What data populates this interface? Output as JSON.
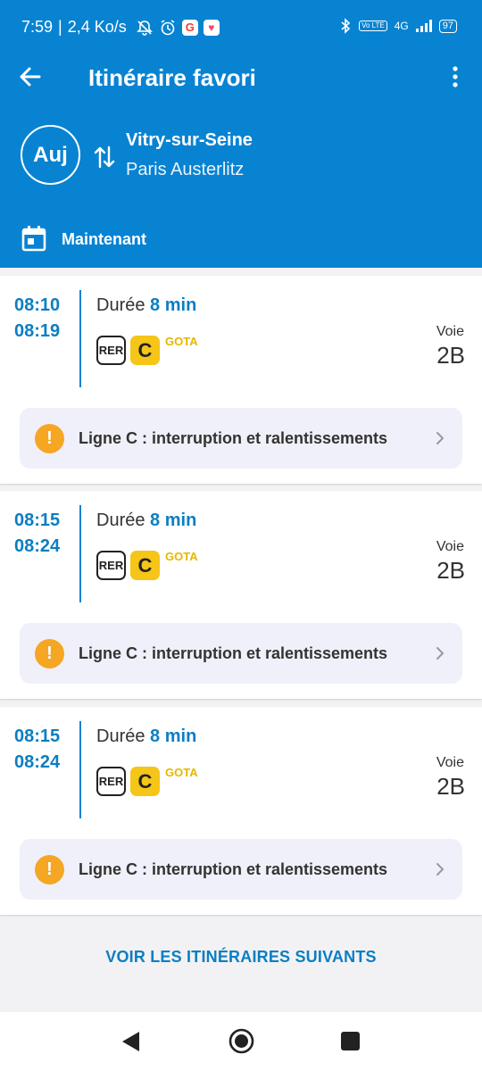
{
  "status_bar": {
    "time": "7:59",
    "separator": "|",
    "speed": "2,4 Ko/s",
    "g_icon": "G",
    "net_volte": "Vo LTE",
    "net_4g": "4G",
    "battery": "97"
  },
  "header": {
    "title": "Itinéraire favori",
    "day_badge": "Auj",
    "from": "Vitry-sur-Seine",
    "to": "Paris Austerlitz",
    "departure_when": "Maintenant"
  },
  "trips": [
    {
      "depart": "08:10",
      "arrive": "08:19",
      "duration_label": "Durée",
      "duration_value": "8 min",
      "mode": "RER",
      "line": "C",
      "mission": "GOTA",
      "platform_label": "Voie",
      "platform": "2B",
      "alert": "Ligne C : interruption et ralentissements"
    },
    {
      "depart": "08:15",
      "arrive": "08:24",
      "duration_label": "Durée",
      "duration_value": "8 min",
      "mode": "RER",
      "line": "C",
      "mission": "GOTA",
      "platform_label": "Voie",
      "platform": "2B",
      "alert": "Ligne C : interruption et ralentissements"
    },
    {
      "depart": "08:15",
      "arrive": "08:24",
      "duration_label": "Durée",
      "duration_value": "8 min",
      "mode": "RER",
      "line": "C",
      "mission": "GOTA",
      "platform_label": "Voie",
      "platform": "2B",
      "alert": "Ligne C : interruption et ralentissements"
    }
  ],
  "more_button": "VOIR LES ITINÉRAIRES SUIVANTS",
  "colors": {
    "primary": "#0883d2",
    "time_text": "#0b7ec2",
    "line_c": "#f5c518",
    "alert_icon": "#f5a623",
    "alert_bg": "#f0f0fa"
  },
  "icons": {
    "back": "arrow-left-icon",
    "menu": "more-vert-icon",
    "swap": "swap-vertical-icon",
    "calendar": "calendar-icon",
    "alert": "exclamation-icon",
    "chevron": "chevron-right-icon"
  }
}
